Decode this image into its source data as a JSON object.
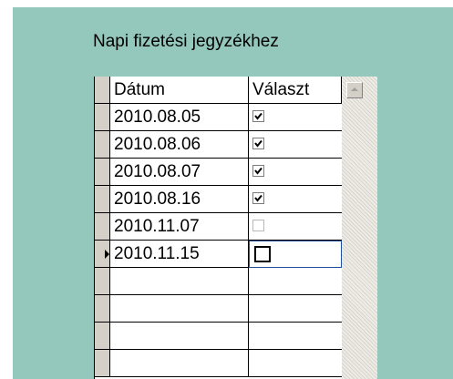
{
  "form": {
    "title": "Napi fizetési jegyzékhez"
  },
  "grid": {
    "columns": {
      "date": "Dátum",
      "select": "Választ"
    },
    "rows": [
      {
        "date": "2010.08.05",
        "selected": true
      },
      {
        "date": "2010.08.06",
        "selected": true
      },
      {
        "date": "2010.08.07",
        "selected": true
      },
      {
        "date": "2010.08.16",
        "selected": true
      },
      {
        "date": "2010.11.07",
        "selected": false
      },
      {
        "date": "2010.11.15",
        "selected": false,
        "current": true
      }
    ]
  },
  "icons": {
    "record_selector": "arrow-right-icon",
    "check": "checkmark-icon",
    "scroll_up": "triangle-up-icon"
  },
  "colors": {
    "panel_background": "#95c8bd",
    "focus_border": "#1f4f9a"
  }
}
